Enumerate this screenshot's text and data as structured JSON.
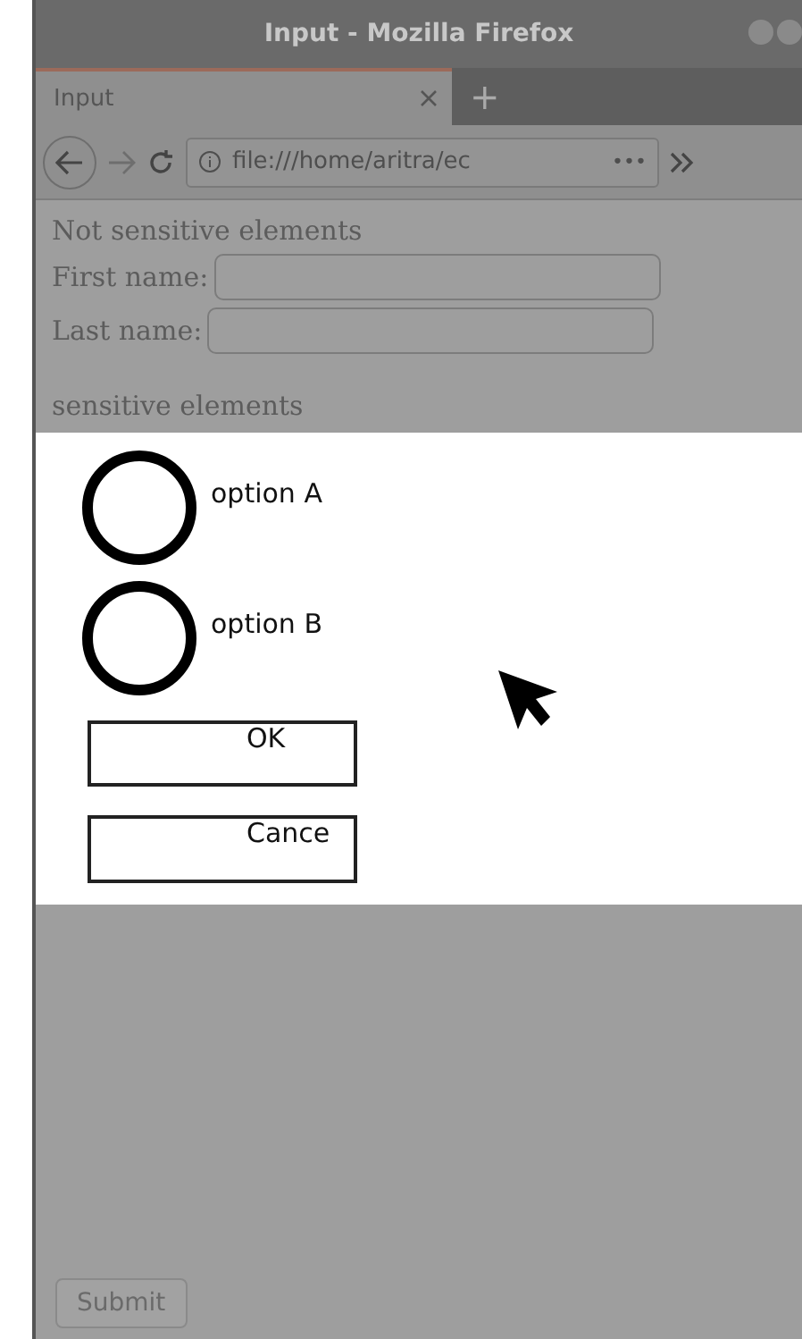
{
  "window": {
    "title": "Input - Mozilla Firefox"
  },
  "tabs": [
    {
      "label": "Input",
      "selected": true
    }
  ],
  "new_tab": "+",
  "address_bar": {
    "value": "file:///home/aritra/ec",
    "more": "•••"
  },
  "page": {
    "heading": "Not sensitive elements",
    "fields": [
      {
        "label": "First name:"
      },
      {
        "label": "Last name:"
      }
    ],
    "sensitive_heading": "sensitive elements",
    "submit": "Submit"
  },
  "dialog": {
    "options": [
      {
        "label": "option A",
        "selected": false
      },
      {
        "label": "option B",
        "selected": false
      }
    ],
    "buttons": [
      "OK",
      "Cance"
    ]
  }
}
